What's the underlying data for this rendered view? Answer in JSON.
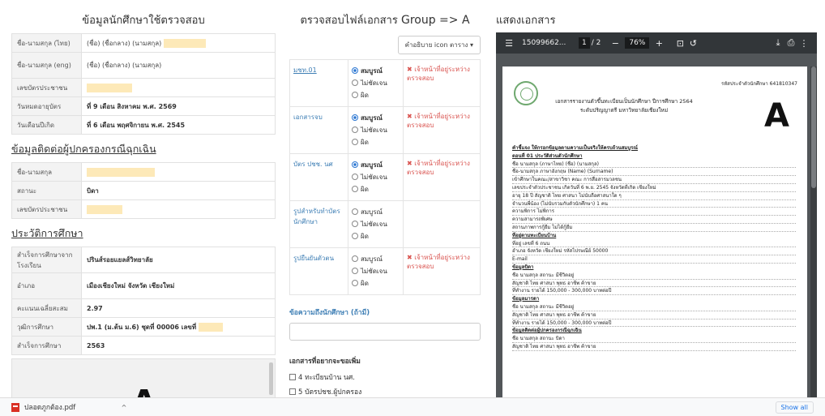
{
  "left": {
    "title": "ข้อมูลนักศึกษาใช้ตรวจสอบ",
    "student_rows": [
      {
        "label": "ชื่อ-นามสกุล (ไทย)",
        "value": "(ชื่อ)     (ชื่อกลาง) (นามสกุล)"
      },
      {
        "label": "ชื่อ-นามสกุล (eng)",
        "value": "(ชื่อ)              (ชื่อกลาง) (นามสกุล)"
      },
      {
        "label": "เลขบัตรประชาชน",
        "value": ""
      },
      {
        "label": "วันหมดอายุบัตร",
        "value": "ที่ 9 เดือน สิงหาคม พ.ศ. 2569"
      },
      {
        "label": "วันเดือนปีเกิด",
        "value": "ที่ 6 เดือน พฤศจิกายน พ.ศ. 2545"
      }
    ],
    "emergency_title": "ข้อมูลติดต่อผู้ปกครองกรณีฉุกเฉิน",
    "emergency_rows": [
      {
        "label": "ชื่อ-นามสกุล",
        "value": ""
      },
      {
        "label": "สถานะ",
        "value": "บิดา"
      },
      {
        "label": "เลขบัตรประชาชน",
        "value": ""
      }
    ],
    "edu_title": "ประวัติการศึกษา",
    "edu_rows": [
      {
        "label": "สำเร็จการศึกษาจากโรงเรียน",
        "value": "ปรินส์รอยแยลส์วิทยาลัย"
      },
      {
        "label": "อำเภอ",
        "value": "เมืองเชียงใหม่ จังหวัด เชียงใหม่"
      },
      {
        "label": "คะแนนเฉลี่ยสะสม",
        "value": "2.97"
      },
      {
        "label": "วุฒิการศึกษา",
        "value": "ปพ.1 (ม.ต้น ม.6) ชุดที่ 00006 เลขที่"
      },
      {
        "label": "สำเร็จการศึกษา",
        "value": "2563"
      }
    ],
    "preview_letter": "A"
  },
  "middle": {
    "title_prefix": "ตรวจสอบไฟล์เอกสาร",
    "title_group": "Group => A",
    "select_label": "คำอธิบาย icon ตาราง ▾",
    "options": {
      "complete": "สมบูรณ์",
      "unclear": "ไม่ชัดเจน",
      "wrong": "ผิด"
    },
    "docs": [
      {
        "name": "มชท.01",
        "link": true,
        "selected": "complete",
        "status": "✖ เจ้าหน้าที่อยู่ระหว่างตรวจสอบ"
      },
      {
        "name": "เอกสารจบ",
        "link": false,
        "selected": "complete",
        "status": "✖ เจ้าหน้าที่อยู่ระหว่างตรวจสอบ"
      },
      {
        "name": "บัตร ปชช. นศ",
        "link": false,
        "selected": "complete",
        "status": "✖ เจ้าหน้าที่อยู่ระหว่างตรวจสอบ"
      },
      {
        "name": "รูปสำหรับทำบัตรนักศึกษา",
        "link": false,
        "selected": "",
        "status": ""
      },
      {
        "name": "รูปยืนยันตัวตน",
        "link": false,
        "selected": "",
        "status": "✖ เจ้าหน้าที่อยู่ระหว่างตรวจสอบ"
      }
    ],
    "message_label": "ข้อความถึงนักศึกษา (ถ้ามี)",
    "extra_title": "เอกสารที่อยากจะขอเพิ่ม",
    "extra_items": [
      "4 ทะเบียนบ้าน นศ.",
      "5 บัตรปชช.ผู้ปกครอง"
    ]
  },
  "right": {
    "title": "แสดงเอกสาร",
    "viewer": {
      "filename": "15099662...",
      "page_current": "1",
      "page_total": "/ 2",
      "zoom": "76%"
    },
    "paper": {
      "ref": "รหัสประจำตัวนักศึกษา 641810347",
      "header1": "เอกสารรายงานตัวขึ้นทะเบียนเป็นนักศึกษา ปีการศึกษา 2564",
      "header2": "ระดับปริญญาตรี มหาวิทยาลัยเชียงใหม่",
      "group_letter": "A",
      "lines": [
        "คำชี้แจง ให้กรอกข้อมูลตามความเป็นจริงให้ครบถ้วนสมบูรณ์",
        "ตอนที่ 01 ประวัติส่วนตัวนักศึกษา",
        "ชื่อ นามสกุล (ภาษาไทย)   (ชื่อ)   (นามสกุล)",
        "ชื่อ-นามสกุล ภาษาอังกฤษ   (Name)   (Surname)",
        "เข้าศึกษาในคณะ/สาขาวิชา   คณะ การสื่อสารมวลชน",
        "เลขประจำตัวประชาชน   เกิดวันที่ 6 พ.ย. 2545   จังหวัดที่เกิด เชียงใหม่",
        "อายุ 18 ปี   สัญชาติ ไทย   ศาสนา ไม่นับถือศาสนาใด ๆ",
        "จำนวนพี่น้อง (ไม่นับรวมกับตัวนักศึกษา) 1 คน",
        "ความพิการ ไม่พิการ",
        "ความสามารถพิเศษ",
        "สถานภาพการกู้ยืม ไม่ได้กู้ยืม",
        "ที่อยู่ตามทะเบียนบ้าน",
        "ที่อยู่ เลขที่ 6   ถนน",
        "อำเภอ   จังหวัด เชียงใหม่   รหัสไปรษณีย์ 50000",
        "E-mail",
        "ข้อมูลบิดา",
        "ชื่อ นามสกุล   สถานะ มีชีวิตอยู่",
        "สัญชาติ ไทย   ศาสนา พุทธ   อาชีพ ค้าขาย",
        "ที่ทำงาน   รายได้ 150,000 - 300,000 บาทต่อปี",
        "ข้อมูลมารดา",
        "ชื่อ นามสกุล   สถานะ มีชีวิตอยู่",
        "สัญชาติ ไทย   ศาสนา พุทธ   อาชีพ ค้าขาย",
        "ที่ทำงาน   รายได้ 150,000 - 300,000 บาทต่อปี",
        "ข้อมูลติดต่อผู้ปกครองกรณีฉุกเฉิน",
        "ชื่อ นามสกุล   สถานะ บิดา",
        "สัญชาติ ไทย   ศาสนา พุทธ   อาชีพ ค้าขาย"
      ]
    }
  },
  "download_bar": {
    "file_name": "ปลอดภูกต้อง.pdf",
    "show_all": "Show all"
  }
}
